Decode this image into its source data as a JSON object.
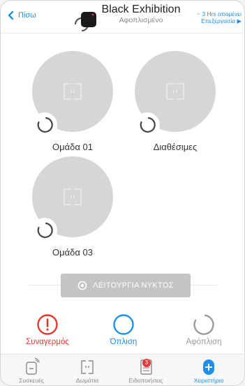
{
  "header": {
    "back_label": "Πίσω",
    "title": "Black Exhibition",
    "subtitle": "Αφοπλισμένο",
    "ago_text": "~ 3 Hrs απομένει",
    "edit_label": "Επεξεργασία ▶"
  },
  "rooms": [
    {
      "label": "Ομάδα 01"
    },
    {
      "label": "Διαθέσιμες"
    },
    {
      "label": "Ομάδα 03"
    }
  ],
  "night_mode": {
    "label": "ΛΕΙΤΟΥΡΓΙΑ ΝΥΚΤΟΣ"
  },
  "controls": {
    "alarm": {
      "label": "Συναγερμός",
      "color": "#e2372b"
    },
    "arm": {
      "label": "Όπλιση",
      "color": "#1e8fe8"
    },
    "disarm": {
      "label": "Αφόπλιση",
      "color": "#9a9a9a"
    }
  },
  "bottom_nav": {
    "devices": "Συσκευές",
    "rooms": "Δωμάτια",
    "notifications": "Ειδοποιήσεις",
    "notifications_count": "3",
    "control": "Χειριστήριο"
  },
  "colors": {
    "accent": "#1e8fe8",
    "room_circle": "#d6d6d6",
    "night_button": "#c4c4c4"
  }
}
